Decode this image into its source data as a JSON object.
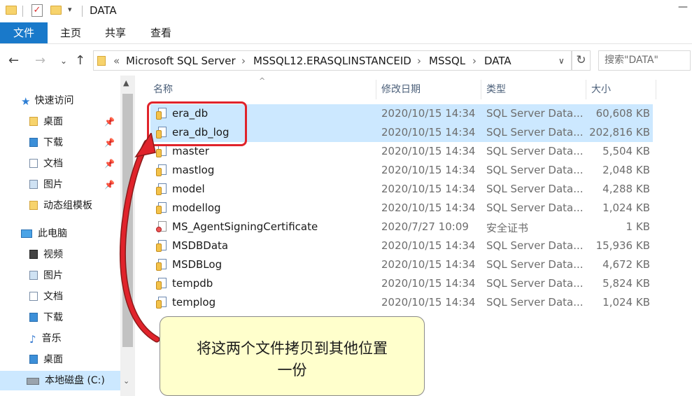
{
  "window": {
    "title": "DATA"
  },
  "ribbon": {
    "tabs": [
      "文件",
      "主页",
      "共享",
      "查看"
    ]
  },
  "address": {
    "crumbs": [
      "Microsoft SQL Server",
      "MSSQL12.ERASQLINSTANCEID",
      "MSSQL",
      "DATA"
    ],
    "search_placeholder": "搜索\"DATA\""
  },
  "sidebar": {
    "items": [
      {
        "label": "快速访问",
        "icon": "star-icon"
      },
      {
        "label": "桌面",
        "icon": "folder-icon",
        "pinned": true
      },
      {
        "label": "下载",
        "icon": "download-icon",
        "pinned": true
      },
      {
        "label": "文档",
        "icon": "document-icon",
        "pinned": true
      },
      {
        "label": "图片",
        "icon": "picture-icon",
        "pinned": true
      },
      {
        "label": "动态组模板",
        "icon": "folder-icon"
      },
      {
        "label": "此电脑",
        "icon": "computer-icon"
      },
      {
        "label": "视频",
        "icon": "video-icon"
      },
      {
        "label": "图片",
        "icon": "picture-icon"
      },
      {
        "label": "文档",
        "icon": "document-icon"
      },
      {
        "label": "下载",
        "icon": "download-icon"
      },
      {
        "label": "音乐",
        "icon": "music-icon"
      },
      {
        "label": "桌面",
        "icon": "folder-icon"
      },
      {
        "label": "本地磁盘 (C:)",
        "icon": "drive-icon"
      }
    ]
  },
  "columns": {
    "name": "名称",
    "date": "修改日期",
    "type": "类型",
    "size": "大小"
  },
  "files": [
    {
      "name": "era_db",
      "date": "2020/10/15 14:34",
      "type": "SQL Server Data...",
      "size": "60,608 KB",
      "selected": true
    },
    {
      "name": "era_db_log",
      "date": "2020/10/15 14:34",
      "type": "SQL Server Data...",
      "size": "202,816 KB",
      "selected": true
    },
    {
      "name": "master",
      "date": "2020/10/15 14:34",
      "type": "SQL Server Data...",
      "size": "5,504 KB"
    },
    {
      "name": "mastlog",
      "date": "2020/10/15 14:34",
      "type": "SQL Server Data...",
      "size": "2,048 KB"
    },
    {
      "name": "model",
      "date": "2020/10/15 14:34",
      "type": "SQL Server Data...",
      "size": "4,288 KB"
    },
    {
      "name": "modellog",
      "date": "2020/10/15 14:34",
      "type": "SQL Server Data...",
      "size": "1,024 KB"
    },
    {
      "name": "MS_AgentSigningCertificate",
      "date": "2020/7/27 10:09",
      "type": "安全证书",
      "size": "1 KB"
    },
    {
      "name": "MSDBData",
      "date": "2020/10/15 14:34",
      "type": "SQL Server Data...",
      "size": "15,936 KB"
    },
    {
      "name": "MSDBLog",
      "date": "2020/10/15 14:34",
      "type": "SQL Server Data...",
      "size": "4,672 KB"
    },
    {
      "name": "tempdb",
      "date": "2020/10/15 14:34",
      "type": "SQL Server Data...",
      "size": "5,824 KB"
    },
    {
      "name": "templog",
      "date": "2020/10/15 14:34",
      "type": "SQL Server Data...",
      "size": "1,024 KB"
    }
  ],
  "annotation": {
    "line1": "将这两个文件拷贝到其他位置",
    "line2": "一份"
  },
  "colors": {
    "accent": "#1979ca",
    "selection": "#cce8ff",
    "highlight": "#e0232b",
    "callout": "#ffffcc"
  }
}
